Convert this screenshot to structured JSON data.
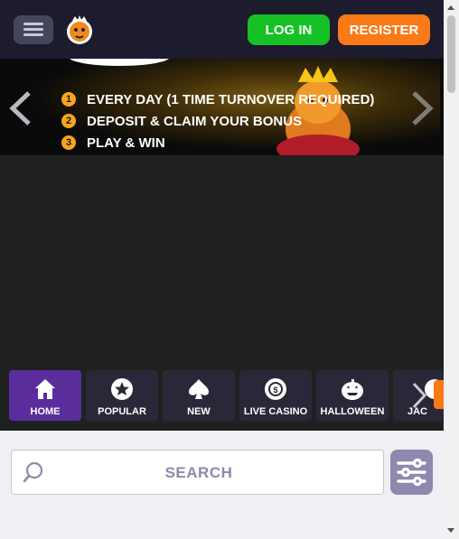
{
  "header": {
    "login_label": "LOG IN",
    "register_label": "REGISTER"
  },
  "banner": {
    "steps": [
      {
        "num": "1",
        "text": "EVERY DAY (1 TIME TURNOVER REQUIRED)"
      },
      {
        "num": "2",
        "text": "DEPOSIT & CLAIM YOUR BONUS"
      },
      {
        "num": "3",
        "text": "PLAY & WIN"
      }
    ]
  },
  "categories": [
    {
      "label": "HOME",
      "icon": "home-icon"
    },
    {
      "label": "POPULAR",
      "icon": "star-icon"
    },
    {
      "label": "NEW",
      "icon": "spade-icon"
    },
    {
      "label": "LIVE CASINO",
      "icon": "chip-icon"
    },
    {
      "label": "HALLOWEEN",
      "icon": "pumpkin-icon"
    },
    {
      "label": "JAC",
      "icon": "jackpot-icon"
    }
  ],
  "search": {
    "placeholder": "SEARCH"
  },
  "colors": {
    "header_bg": "#1d1b2e",
    "login": "#16c125",
    "register": "#fa7a18",
    "active_category": "#5a2d9c",
    "category_bg": "#2a2838",
    "accent_filter": "#8f89ad"
  }
}
